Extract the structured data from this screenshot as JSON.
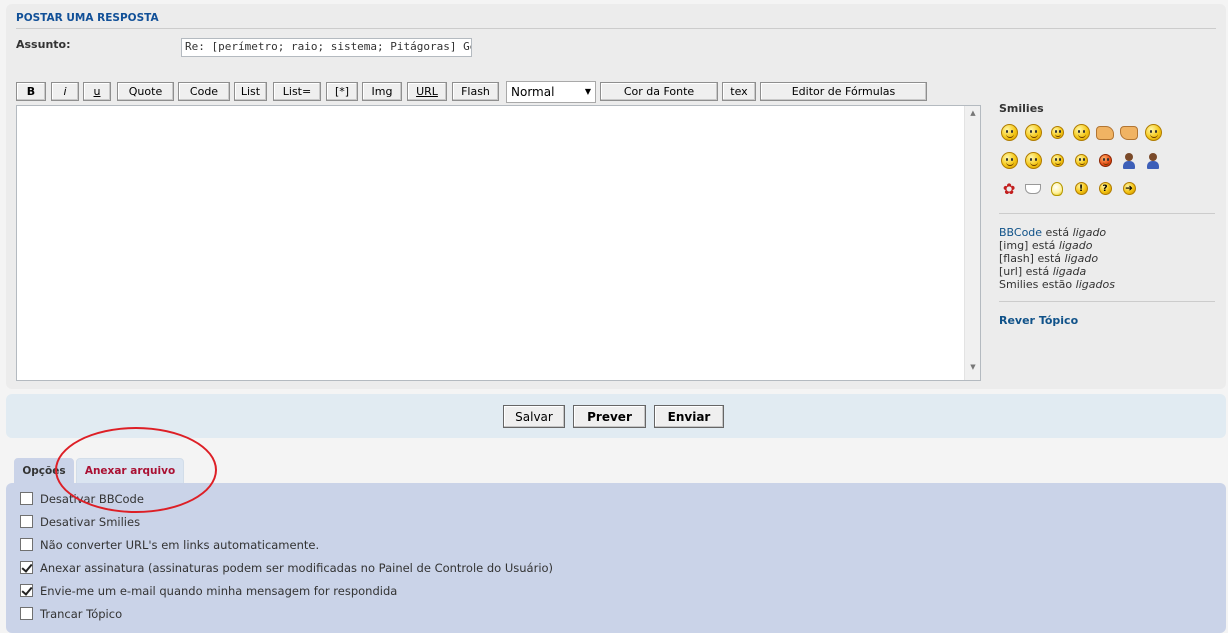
{
  "section_title": "POSTAR UMA RESPOSTA",
  "subject": {
    "label": "Assunto:",
    "value": "Re: [perímetro; raio; sistema; Pitágoras] Geometria"
  },
  "toolbar": {
    "bold": "B",
    "italic": "i",
    "underline": "u",
    "quote": "Quote",
    "code": "Code",
    "list": "List",
    "list_eq": "List=",
    "list_item": "[*]",
    "img": "Img",
    "url": "URL",
    "flash": "Flash",
    "font_size_selected": "Normal",
    "font_color": "Cor da Fonte",
    "tex": "tex",
    "formula_editor": "Editor de Fórmulas"
  },
  "editor": {
    "value": ""
  },
  "smilies": {
    "title": "Smilies",
    "items": [
      "smile-icon",
      "grin-icon",
      "wink-icon",
      "neutral-icon",
      "thumbs-up-icon",
      "thumbs-down-icon",
      "confused-icon",
      "surprised-icon",
      "shock-icon",
      "party-icon",
      "laugh-icon",
      "mad-icon",
      "computer-guy-icon",
      "person-icon",
      "rose-icon",
      "coffee-icon",
      "idea-icon",
      "exclaim-icon",
      "question-icon",
      "arrow-icon"
    ]
  },
  "bbcode_status": {
    "bbcode_link": "BBCode",
    "bbcode_text": " está ",
    "bbcode_state": "ligado",
    "img_text": "[img] está ",
    "img_state": "ligado",
    "flash_text": "[flash] está ",
    "flash_state": "ligado",
    "url_text": "[url] está ",
    "url_state": "ligada",
    "smilies_text": "Smilies estão ",
    "smilies_state": "ligados"
  },
  "review_topic": "Rever Tópico",
  "actions": {
    "save": "Salvar",
    "preview": "Prever",
    "submit": "Enviar"
  },
  "tabs": {
    "options": "Opções",
    "attach": "Anexar arquivo"
  },
  "options": [
    {
      "label": "Desativar BBCode",
      "checked": false
    },
    {
      "label": "Desativar Smilies",
      "checked": false
    },
    {
      "label": "Não converter URL's em links automaticamente.",
      "checked": false
    },
    {
      "label": "Anexar assinatura (assinaturas podem ser modificadas no Painel de Controle do Usuário)",
      "checked": true
    },
    {
      "label": "Envie-me um e-mail quando minha mensagem for respondida",
      "checked": true
    },
    {
      "label": "Trancar Tópico",
      "checked": false
    }
  ],
  "colors": {
    "title_blue": "#115098",
    "link_blue": "#105289",
    "attach_tab_red": "#aa1133",
    "annotation_red": "#dd1f26"
  }
}
